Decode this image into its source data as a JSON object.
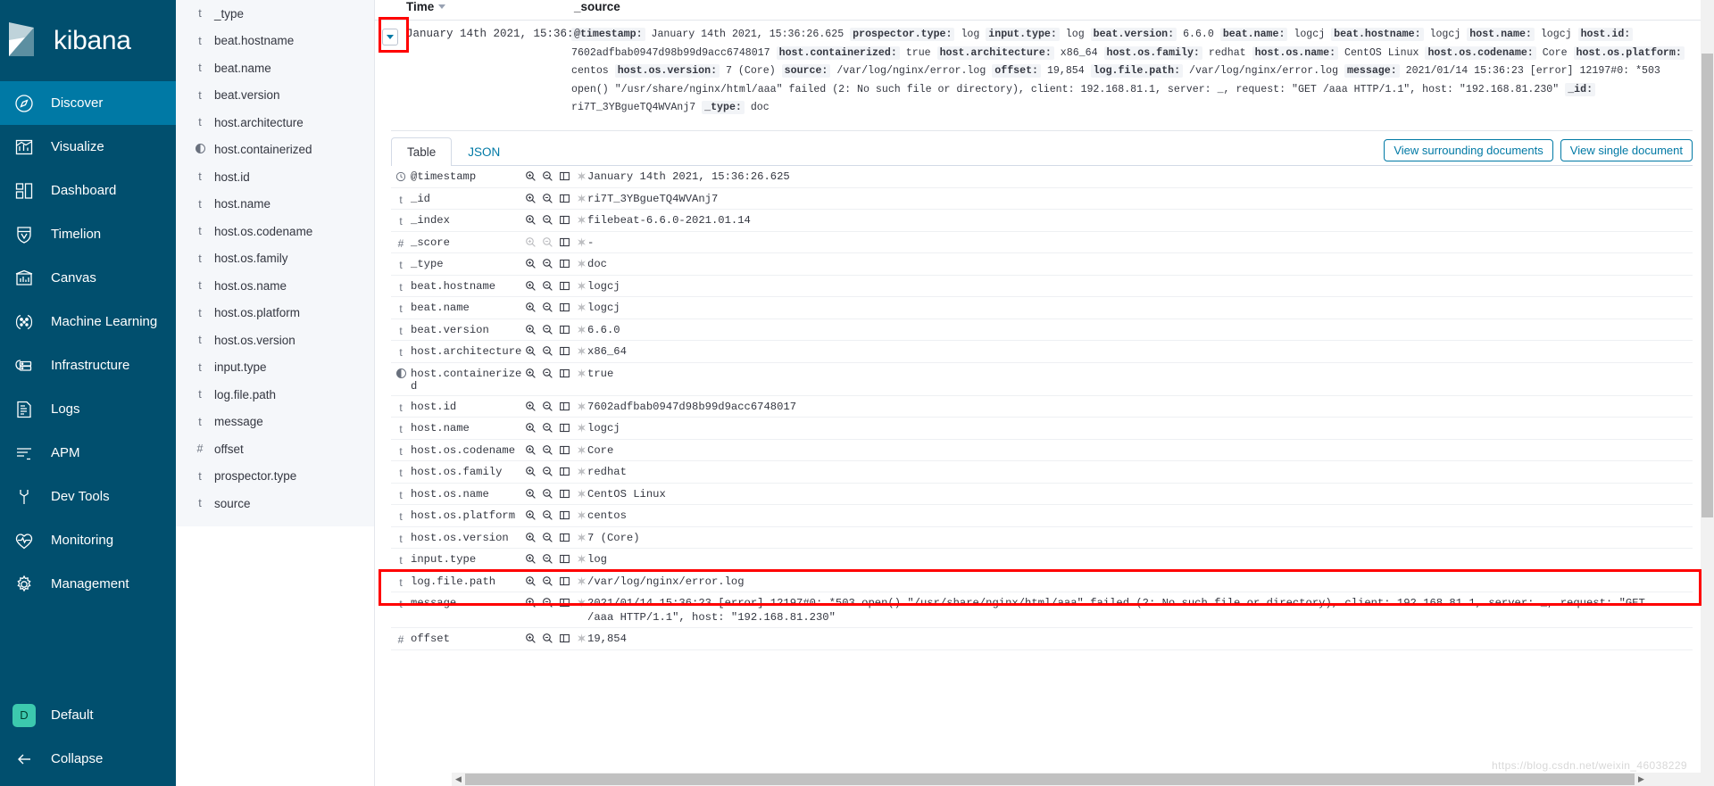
{
  "app": {
    "brand": "kibana",
    "brand_logo_icon": "kibana-logo-icon"
  },
  "sidebar": {
    "items": [
      {
        "label": "Discover",
        "icon": "compass-icon",
        "active": true
      },
      {
        "label": "Visualize",
        "icon": "bar-chart-icon",
        "active": false
      },
      {
        "label": "Dashboard",
        "icon": "dashboard-grid-icon",
        "active": false
      },
      {
        "label": "Timelion",
        "icon": "timelion-shield-icon",
        "active": false
      },
      {
        "label": "Canvas",
        "icon": "canvas-frame-icon",
        "active": false
      },
      {
        "label": "Machine Learning",
        "icon": "machine-learning-icon",
        "active": false
      },
      {
        "label": "Infrastructure",
        "icon": "infrastructure-server-icon",
        "active": false
      },
      {
        "label": "Logs",
        "icon": "logs-document-icon",
        "active": false
      },
      {
        "label": "APM",
        "icon": "apm-lines-icon",
        "active": false
      },
      {
        "label": "Dev Tools",
        "icon": "wrench-icon",
        "active": false
      },
      {
        "label": "Monitoring",
        "icon": "heartbeat-icon",
        "active": false
      },
      {
        "label": "Management",
        "icon": "gear-icon",
        "active": false
      }
    ],
    "space": {
      "label": "Default",
      "initial": "D",
      "avatar_color": "#3cc9ae"
    },
    "collapse": {
      "label": "Collapse",
      "icon": "arrow-left-icon"
    }
  },
  "field_panel": {
    "fields": [
      {
        "type": "t",
        "name": "_type"
      },
      {
        "type": "t",
        "name": "beat.hostname"
      },
      {
        "type": "t",
        "name": "beat.name"
      },
      {
        "type": "t",
        "name": "beat.version"
      },
      {
        "type": "t",
        "name": "host.architecture"
      },
      {
        "type": "bool",
        "name": "host.containerized"
      },
      {
        "type": "t",
        "name": "host.id"
      },
      {
        "type": "t",
        "name": "host.name"
      },
      {
        "type": "t",
        "name": "host.os.codename"
      },
      {
        "type": "t",
        "name": "host.os.family"
      },
      {
        "type": "t",
        "name": "host.os.name"
      },
      {
        "type": "t",
        "name": "host.os.platform"
      },
      {
        "type": "t",
        "name": "host.os.version"
      },
      {
        "type": "t",
        "name": "input.type"
      },
      {
        "type": "t",
        "name": "log.file.path"
      },
      {
        "type": "t",
        "name": "message"
      },
      {
        "type": "#",
        "name": "offset"
      },
      {
        "type": "t",
        "name": "prospector.type"
      },
      {
        "type": "t",
        "name": "source"
      }
    ]
  },
  "doc_table": {
    "columns": {
      "time": "Time",
      "source": "_source"
    },
    "sort_icon": "sort-descending-caret-icon",
    "expand_icon": "expand-row-caret-icon",
    "row": {
      "time": "January 14th 2021, 15:36:26.625",
      "source_pairs": [
        {
          "key": "@timestamp:",
          "value": "January 14th 2021, 15:36:26.625"
        },
        {
          "key": "prospector.type:",
          "value": "log"
        },
        {
          "key": "input.type:",
          "value": "log"
        },
        {
          "key": "beat.version:",
          "value": "6.6.0"
        },
        {
          "key": "beat.name:",
          "value": "logcj"
        },
        {
          "key": "beat.hostname:",
          "value": "logcj"
        },
        {
          "key": "host.name:",
          "value": "logcj"
        },
        {
          "key": "host.id:",
          "value": "7602adfbab0947d98b99d9acc6748017"
        },
        {
          "key": "host.containerized:",
          "value": "true"
        },
        {
          "key": "host.architecture:",
          "value": "x86_64"
        },
        {
          "key": "host.os.family:",
          "value": "redhat"
        },
        {
          "key": "host.os.name:",
          "value": "CentOS Linux"
        },
        {
          "key": "host.os.codename:",
          "value": "Core"
        },
        {
          "key": "host.os.platform:",
          "value": "centos"
        },
        {
          "key": "host.os.version:",
          "value": "7 (Core)"
        },
        {
          "key": "source:",
          "value": "/var/log/nginx/error.log"
        },
        {
          "key": "offset:",
          "value": "19,854"
        },
        {
          "key": "log.file.path:",
          "value": "/var/log/nginx/error.log"
        },
        {
          "key": "message:",
          "value": "2021/01/14 15:36:23 [error] 12197#0: *503 open() \"/usr/share/nginx/html/aaa\" failed (2: No such file or directory), client: 192.168.81.1, server: _, request: \"GET /aaa HTTP/1.1\", host: \"192.168.81.230\""
        },
        {
          "key": "_id:",
          "value": "ri7T_3YBgueTQ4WVAnj7"
        },
        {
          "key": "_type:",
          "value": "doc"
        }
      ]
    }
  },
  "detail": {
    "tabs": [
      {
        "label": "Table",
        "active": true
      },
      {
        "label": "JSON",
        "active": false
      }
    ],
    "actions": [
      {
        "label": "View surrounding documents"
      },
      {
        "label": "View single document"
      }
    ],
    "row_action_icons": [
      "filter-for-value-icon",
      "filter-out-value-icon",
      "toggle-column-in-table-icon",
      "filter-for-field-present-icon"
    ],
    "rows": [
      {
        "type": "clock",
        "name": "@timestamp",
        "value": "January 14th 2021, 15:36:26.625",
        "dim_filters": false
      },
      {
        "type": "t",
        "name": "_id",
        "value": "ri7T_3YBgueTQ4WVAnj7",
        "dim_filters": false
      },
      {
        "type": "t",
        "name": "_index",
        "value": "filebeat-6.6.0-2021.01.14",
        "dim_filters": false
      },
      {
        "type": "#",
        "name": "_score",
        "value": "-",
        "dim_filters": true
      },
      {
        "type": "t",
        "name": "_type",
        "value": "doc",
        "dim_filters": false
      },
      {
        "type": "t",
        "name": "beat.hostname",
        "value": "logcj",
        "dim_filters": false
      },
      {
        "type": "t",
        "name": "beat.name",
        "value": "logcj",
        "dim_filters": false
      },
      {
        "type": "t",
        "name": "beat.version",
        "value": "6.6.0",
        "dim_filters": false
      },
      {
        "type": "t",
        "name": "host.architecture",
        "value": "x86_64",
        "dim_filters": false
      },
      {
        "type": "bool",
        "name": "host.containerized",
        "value": "true",
        "dim_filters": false
      },
      {
        "type": "t",
        "name": "host.id",
        "value": "7602adfbab0947d98b99d9acc6748017",
        "dim_filters": false
      },
      {
        "type": "t",
        "name": "host.name",
        "value": "logcj",
        "dim_filters": false
      },
      {
        "type": "t",
        "name": "host.os.codename",
        "value": "Core",
        "dim_filters": false
      },
      {
        "type": "t",
        "name": "host.os.family",
        "value": "redhat",
        "dim_filters": false
      },
      {
        "type": "t",
        "name": "host.os.name",
        "value": "CentOS Linux",
        "dim_filters": false
      },
      {
        "type": "t",
        "name": "host.os.platform",
        "value": "centos",
        "dim_filters": false
      },
      {
        "type": "t",
        "name": "host.os.version",
        "value": "7 (Core)",
        "dim_filters": false
      },
      {
        "type": "t",
        "name": "input.type",
        "value": "log",
        "dim_filters": false
      },
      {
        "type": "t",
        "name": "log.file.path",
        "value": "/var/log/nginx/error.log",
        "dim_filters": false
      },
      {
        "type": "t",
        "name": "message",
        "value": "2021/01/14 15:36:23 [error] 12197#0: *503 open() \"/usr/share/nginx/html/aaa\" failed (2: No such file or directory), client: 192.168.81.1, server: _, request: \"GET /aaa HTTP/1.1\", host: \"192.168.81.230\"",
        "dim_filters": false
      },
      {
        "type": "#",
        "name": "offset",
        "value": "19,854",
        "dim_filters": false
      }
    ]
  },
  "annotations": {
    "highlight_color": "#ff0000",
    "boxes": [
      "expand-row-button-highlight",
      "message-row-highlight"
    ]
  },
  "scrollbars": {
    "vertical": "page-vertical-scrollbar",
    "horizontal": "table-horizontal-scrollbar"
  },
  "watermark": "https://blog.csdn.net/weixin_46038229"
}
